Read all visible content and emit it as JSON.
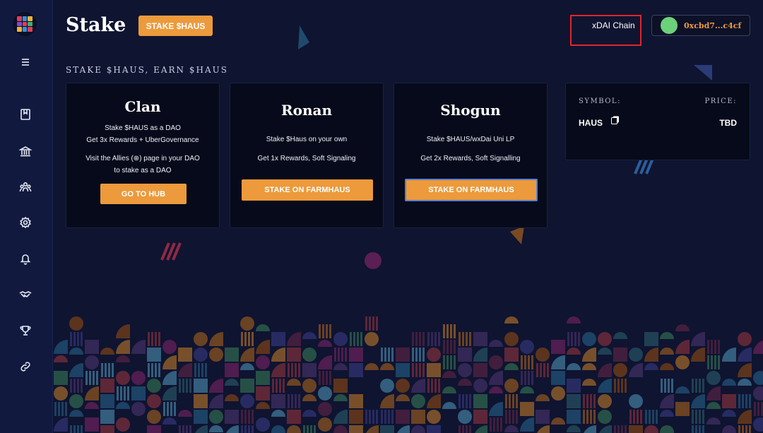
{
  "sidebar": {
    "menu_icon": "hamburger-icon",
    "items": [
      {
        "icon": "book-icon"
      },
      {
        "icon": "bank-icon"
      },
      {
        "icon": "members-icon"
      },
      {
        "icon": "gear-icon"
      },
      {
        "icon": "bell-icon"
      },
      {
        "icon": "handshake-icon"
      },
      {
        "icon": "trophy-icon"
      },
      {
        "icon": "link-icon"
      }
    ]
  },
  "header": {
    "title": "Stake",
    "stake_button": "STAKE $HAUS",
    "chain": "xDAI Chain",
    "account": "0xcbd7...c4cf"
  },
  "section_heading": "STAKE $HAUS, EARN $HAUS",
  "cards": [
    {
      "title": "Clan",
      "line1": "Stake $HAUS as a DAO",
      "line2": "Get 3x Rewards + UberGovernance",
      "line3": "Visit the Allies (⊕) page in your DAO",
      "line4": "to stake as a DAO",
      "button": "GO TO HUB"
    },
    {
      "title": "Ronan",
      "line1": "Stake $Haus on your own",
      "line2": "Get 1x Rewards, Soft Signaling",
      "button": "STAKE ON FARMHAUS"
    },
    {
      "title": "Shogun",
      "line1": "Stake $HAUS/wxDai Uni LP",
      "line2": "Get 2x Rewards, Soft Signalling",
      "button": "STAKE ON FARMHAUS"
    }
  ],
  "token_info": {
    "symbol_label": "SYMBOL:",
    "symbol": "HAUS",
    "price_label": "PRICE:",
    "price": "TBD"
  },
  "colors": {
    "accent": "#ec9a3b",
    "background": "#0f1430",
    "card": "#070a1a",
    "highlight_box": "#e0262b"
  }
}
